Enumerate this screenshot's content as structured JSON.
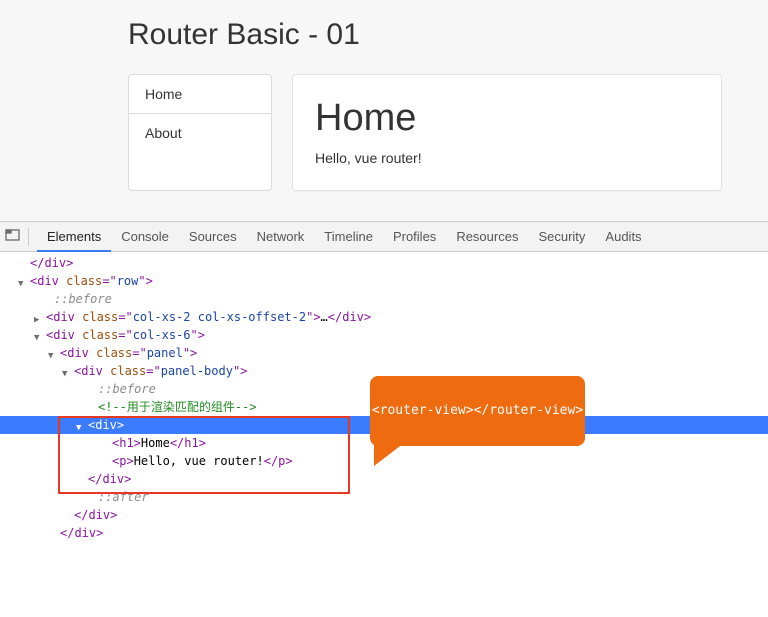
{
  "app": {
    "title": "Router Basic - 01",
    "nav": [
      {
        "label": "Home"
      },
      {
        "label": "About"
      }
    ],
    "panel": {
      "heading": "Home",
      "text": "Hello, vue router!"
    }
  },
  "devtools": {
    "tabs": [
      "Elements",
      "Console",
      "Sources",
      "Network",
      "Timeline",
      "Profiles",
      "Resources",
      "Security",
      "Audits"
    ],
    "activeTab": "Elements",
    "callout": "<router-view></router-view>",
    "lines": {
      "l0": "</div>",
      "l1a": "<div ",
      "l1b": "class",
      "l1c": "=\"",
      "l1d": "row",
      "l1e": "\">",
      "l2": "::before",
      "l3a": "<div ",
      "l3b": "class",
      "l3c": "=\"",
      "l3d": "col-xs-2 col-xs-offset-2",
      "l3e": "\">",
      "l3f": "…",
      "l3g": "</div>",
      "l4a": "<div ",
      "l4b": "class",
      "l4c": "=\"",
      "l4d": "col-xs-6",
      "l4e": "\">",
      "l5a": "<div ",
      "l5b": "class",
      "l5c": "=\"",
      "l5d": "panel",
      "l5e": "\">",
      "l6a": "<div ",
      "l6b": "class",
      "l6c": "=\"",
      "l6d": "panel-body",
      "l6e": "\">",
      "l7": "::before",
      "l8a": "<!--",
      "l8b": "用于渲染匹配的组件",
      "l8c": "-->",
      "l9": "<div>",
      "l10a": "<h1>",
      "l10b": "Home",
      "l10c": "</h1>",
      "l11a": "<p>",
      "l11b": "Hello, vue router!",
      "l11c": "</p>",
      "l12": "</div>",
      "l13": "::after",
      "l14": "</div>",
      "l15": "</div>"
    }
  }
}
